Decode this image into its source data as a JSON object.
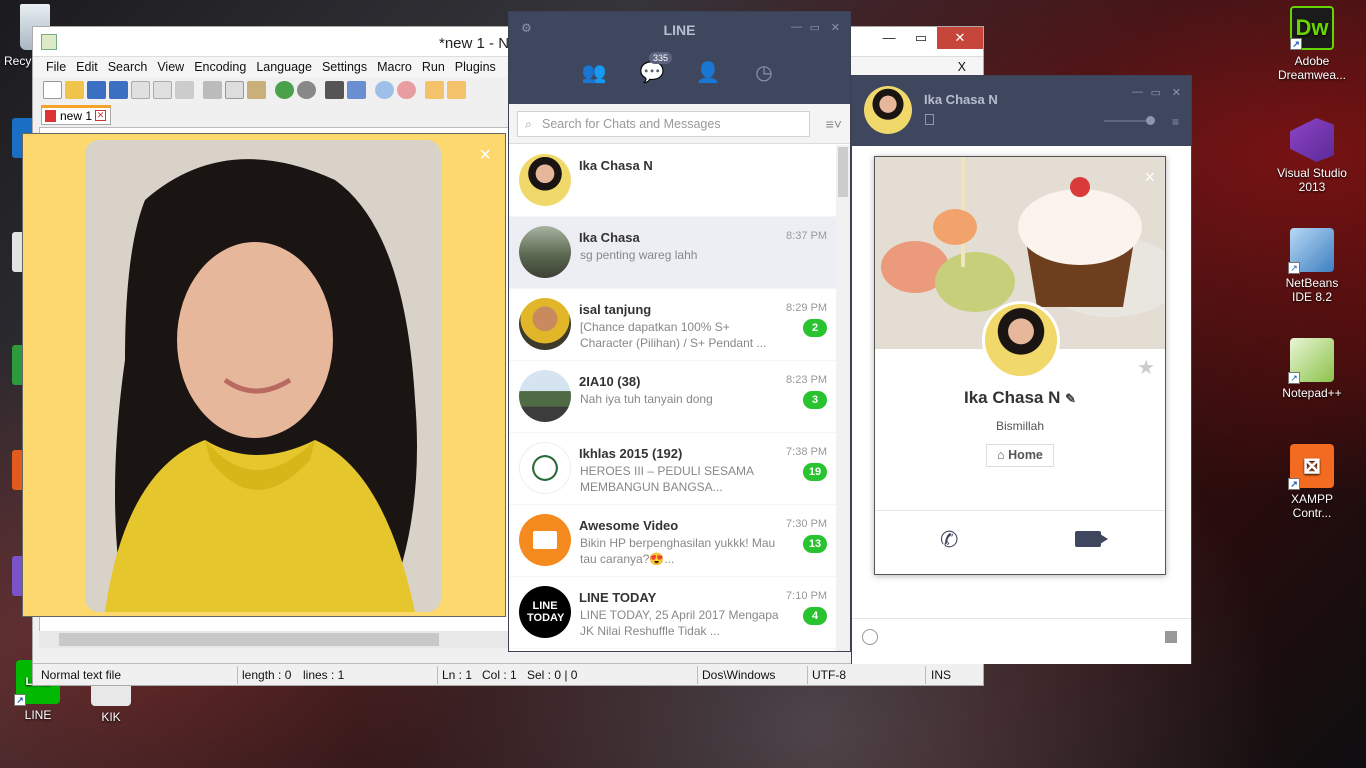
{
  "desktop": {
    "icons_left": [
      {
        "label": "Recy",
        "icon": "recycle-bin-icon"
      },
      {
        "label": "LINE",
        "icon": "line-app-icon"
      },
      {
        "label": "KIK",
        "icon": "kik-icon"
      }
    ],
    "icons_right": [
      {
        "label": "Adobe Dreamwea...",
        "icon": "dreamweaver-icon",
        "glyph": "Dw"
      },
      {
        "label": "Visual Studio 2013",
        "icon": "visual-studio-icon"
      },
      {
        "label": "NetBeans IDE 8.2",
        "icon": "netbeans-icon"
      },
      {
        "label": "Notepad++",
        "icon": "notepadpp-icon"
      },
      {
        "label": "XAMPP Contr...",
        "icon": "xampp-icon"
      }
    ]
  },
  "notepad": {
    "title": "*new 1 - N",
    "menu": [
      "File",
      "Edit",
      "Search",
      "View",
      "Encoding",
      "Language",
      "Settings",
      "Macro",
      "Run",
      "Plugins"
    ],
    "menu_close": "X",
    "tab_label": "new 1",
    "status": {
      "type": "Normal text file",
      "length": "length : 0",
      "lines": "lines : 1",
      "ln": "Ln : 1",
      "col": "Col : 1",
      "sel": "Sel : 0 | 0",
      "eol": "Dos\\Windows",
      "encoding": "UTF-8",
      "mode": "INS"
    }
  },
  "viewer": {
    "close": "×"
  },
  "line_main": {
    "title": "LINE",
    "nav_badge": "335",
    "search_placeholder": "Search for Chats and Messages",
    "chats": [
      {
        "name": "Ika Chasa N",
        "time": "",
        "message": "",
        "count": ""
      },
      {
        "name": "Ika Chasa",
        "time": "8:37 PM",
        "message": "sg penting wareg lahh",
        "count": ""
      },
      {
        "name": "isal tanjung",
        "time": "8:29 PM",
        "message": "[Chance dapatkan 100% S+ Character (Pilihan) / S+ Pendant ...",
        "count": "2"
      },
      {
        "name": "2IA10 (38)",
        "time": "8:23 PM",
        "message": "Nah iya tuh tanyain dong",
        "count": "3"
      },
      {
        "name": "Ikhlas 2015 (192)",
        "time": "7:38 PM",
        "message": "HEROES III – PEDULI SESAMA MEMBANGUN BANGSA...",
        "count": "19"
      },
      {
        "name": "Awesome Video",
        "time": "7:30 PM",
        "message": "Bikin HP berpenghasilan yukkk! Mau tau caranya?😍...",
        "count": "13"
      },
      {
        "name": "LINE TODAY",
        "time": "7:10 PM",
        "message": "LINE TODAY, 25 April 2017 Mengapa JK Nilai Reshuffle Tidak ...",
        "count": "4"
      }
    ]
  },
  "line_chat": {
    "name": "Ika Chasa N",
    "profile_name": "Ika Chasa N",
    "status_message": "Bismillah",
    "home_label": "Home",
    "close": "×"
  },
  "line_today_logo": "LINE TODAY"
}
